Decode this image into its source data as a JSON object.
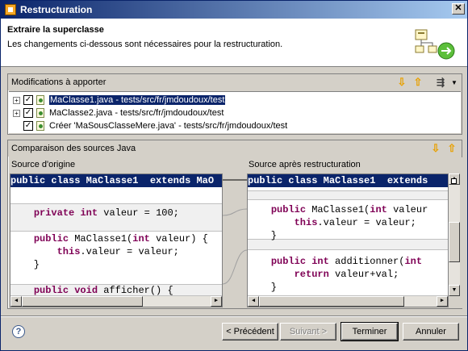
{
  "window": {
    "title": "Restructuration",
    "close_glyph": "✕"
  },
  "banner": {
    "heading": "Extraire la superclasse",
    "message": "Les changements ci-dessous sont nécessaires pour la restructuration."
  },
  "changes": {
    "title": "Modifications à apporter",
    "items": [
      {
        "label": "MaClasse1.java - tests/src/fr/jmdoudoux/test",
        "checked": true,
        "expandable": true,
        "selected": true
      },
      {
        "label": "MaClasse2.java - tests/src/fr/jmdoudoux/test",
        "checked": true,
        "expandable": true,
        "selected": false
      },
      {
        "label": "Créer 'MaSousClasseMere.java' - tests/src/fr/jmdoudoux/test",
        "checked": true,
        "expandable": false,
        "selected": false
      }
    ]
  },
  "compare": {
    "title": "Comparaison des sources Java",
    "left_title": "Source d'origine",
    "right_title": "Source après restructuration",
    "left_lines": [
      "public class MaClasse1  extends MaO",
      "",
      "    private int valeur = 100;",
      "",
      "    public MaClasse1(int valeur) {",
      "        this.valeur = valeur;",
      "    }",
      "",
      "    public void afficher() {"
    ],
    "right_lines": [
      "public class MaClasse1  extends",
      "",
      "    public MaClasse1(int valeur",
      "        this.valeur = valeur;",
      "    }",
      "",
      "    public int additionner(int",
      "        return valeur+val;",
      "    }"
    ]
  },
  "buttons": {
    "help": "?",
    "back": "< Précédent",
    "next": "Suivant >",
    "finish": "Terminer",
    "cancel": "Annuler"
  },
  "colors": {
    "selection": "#0a246a",
    "keyword": "#7f0055",
    "dialog": "#d4d0c8"
  }
}
